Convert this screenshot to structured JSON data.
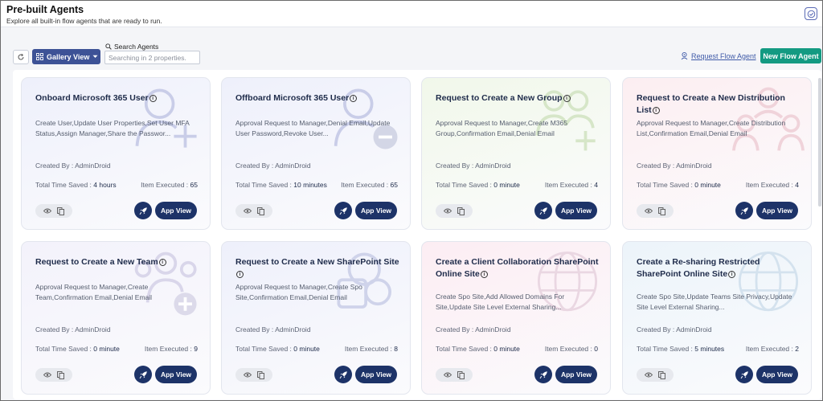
{
  "header": {
    "title": "Pre-built Agents",
    "subtitle": "Explore all built-in flow agents that are ready to run."
  },
  "toolbar": {
    "gallery_view_label": "Gallery View",
    "search_label": "Search Agents",
    "search_placeholder": "Searching in 2 properties.",
    "request_flow_agent_label": "Request Flow Agent",
    "new_flow_agent_label": "New Flow Agent"
  },
  "labels": {
    "app_view": "App View"
  },
  "colors": {
    "primary": "#1d3368",
    "accent_green": "#139a82",
    "gallery_button": "#3d5296"
  },
  "cards": [
    {
      "title": "Onboard Microsoft 365 User",
      "description": "Create User,Update User Properties,Set User MFA Status,Assign Manager,Share the Passwor...",
      "created_by": "Created By : AdminDroid",
      "time_saved_label": "Total Time Saved :",
      "time_saved": "4 hours",
      "items_label": "Item Executed :",
      "items": "65",
      "icon": "user-add-icon",
      "tint": "#eef0fb"
    },
    {
      "title": "Offboard Microsoft 365 User",
      "description": "Approval Request to Manager,Denial Email,Update User Password,Revoke User...",
      "created_by": "Created By : AdminDroid",
      "time_saved_label": "Total Time Saved :",
      "time_saved": "10 minutes",
      "items_label": "Item Executed :",
      "items": "65",
      "icon": "user-remove-icon",
      "tint": "#eef0fb"
    },
    {
      "title": "Request to Create a New Group",
      "description": "Approval Request to Manager,Create M365 Group,Confirmation Email,Denial Email",
      "created_by": "Created By : AdminDroid",
      "time_saved_label": "Total Time Saved :",
      "time_saved": "0 minute",
      "items_label": "Item Executed :",
      "items": "4",
      "icon": "group-add-icon",
      "tint": "#f1f8ea"
    },
    {
      "title": "Request to Create a New Distribution List",
      "description": "Approval Request to Manager,Create Distribution List,Confirmation Email,Denial Email",
      "created_by": "Created By : AdminDroid",
      "time_saved_label": "Total Time Saved :",
      "time_saved": "0 minute",
      "items_label": "Item Executed :",
      "items": "4",
      "icon": "distribution-list-icon",
      "tint": "#fceef1"
    },
    {
      "title": "Request to Create a New Team",
      "description": "Approval Request to Manager,Create Team,Confirmation Email,Denial Email",
      "created_by": "Created By : AdminDroid",
      "time_saved_label": "Total Time Saved :",
      "time_saved": "0 minute",
      "items_label": "Item Executed :",
      "items": "9",
      "icon": "team-add-icon",
      "tint": "#f3f2fb"
    },
    {
      "title": "Request to Create a New SharePoint Site",
      "description": "Approval Request to Manager,Create Spo Site,Confirmation Email,Denial Email",
      "created_by": "Created By : AdminDroid",
      "time_saved_label": "Total Time Saved :",
      "time_saved": "0 minute",
      "items_label": "Item Executed :",
      "items": "8",
      "icon": "sharepoint-site-icon",
      "tint": "#eef0fb"
    },
    {
      "title": "Create a Client Collaboration SharePoint Online Site",
      "description": "Create Spo Site,Add Allowed Domains For Site,Update Site Level External Sharing...",
      "created_by": "Created By : AdminDroid",
      "time_saved_label": "Total Time Saved :",
      "time_saved": "0 minute",
      "items_label": "Item Executed :",
      "items": "0",
      "icon": "globe-icon",
      "tint": "#fcedf3"
    },
    {
      "title": "Create a Re-sharing Restricted SharePoint Online Site",
      "description": "Create Spo Site,Update Teams Site Privacy,Update Site Level External Sharing...",
      "created_by": "Created By : AdminDroid",
      "time_saved_label": "Total Time Saved :",
      "time_saved": "5 minutes",
      "items_label": "Item Executed :",
      "items": "2",
      "icon": "globe-icon",
      "tint": "#ecf4fa"
    }
  ]
}
